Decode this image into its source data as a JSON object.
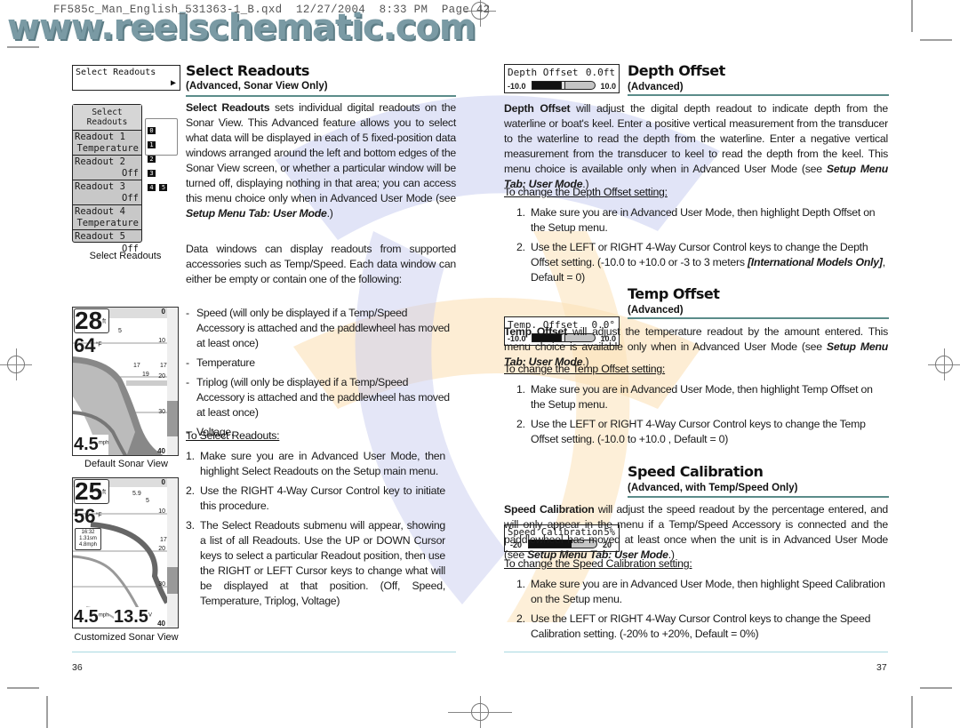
{
  "file_header": "FF585c_Man_English_531363-1_B.qxd  12/27/2004  8:33 PM  Page 42",
  "site_logo": "www.reelschematic.com",
  "left_page": {
    "select_menu_item": {
      "label": "Select Readouts",
      "arrow_icon": "right-triangle-icon"
    },
    "readouts_panel": {
      "title": "Select Readouts",
      "rows": [
        {
          "name": "Readout 1",
          "value": "Temperature"
        },
        {
          "name": "Readout 2",
          "value": "Off"
        },
        {
          "name": "Readout 3",
          "value": "Off"
        },
        {
          "name": "Readout 4",
          "value": "Temperature"
        },
        {
          "name": "Readout 5",
          "value": "Off"
        }
      ],
      "position_map": [
        "0",
        "1",
        "2",
        "3",
        "4",
        "5"
      ]
    },
    "readouts_caption": "Select Readouts",
    "default_sonar": {
      "depth": "28",
      "depth_unit": "ft",
      "temp": "64",
      "temp_unit": "°F",
      "speed": "4.5",
      "speed_unit": "mph",
      "scale": [
        "0",
        "10",
        "20",
        "30",
        "40"
      ],
      "fish_labels": [
        "5",
        "17",
        "19",
        "17"
      ],
      "caption": "Default Sonar View"
    },
    "custom_sonar": {
      "depth": "25",
      "depth_unit": "ft",
      "temp": "56",
      "temp_unit": "°F",
      "triplog": [
        "16:32",
        "1.31sm",
        "4.8mph"
      ],
      "speed": "4.5",
      "speed_unit": "mph",
      "voltage": "13.5",
      "voltage_unit": "V",
      "scale": [
        "0",
        "10",
        "20",
        "30",
        "40"
      ],
      "fish_labels": [
        "5.9",
        "5",
        "17"
      ],
      "caption": "Customized Sonar View"
    },
    "section": {
      "title": "Select Readouts",
      "subtitle": "(Advanced, Sonar View Only)",
      "intro_bold": "Select Readouts",
      "intro_rest": " sets individual digital readouts on the Sonar View. This Advanced feature allows you to select what data will be displayed in each of 5 fixed-position data windows arranged around the left and bottom edges of the Sonar View screen, or whether a particular window will be turned off, displaying nothing in that area; you can access this menu choice only when in Advanced User Mode (see ",
      "intro_ref": "Setup Menu Tab: User Mode",
      "intro_end": ".)",
      "para2": "Data windows can display readouts from supported accessories such as Temp/Speed. Each data window can either be empty or contain one of the following:",
      "options": [
        "Speed (will only be displayed if a Temp/Speed Accessory is attached and the paddlewheel has moved at least once)",
        "Temperature",
        "Triplog (will only be displayed if a Temp/Speed Accessory is attached and the paddlewheel has moved at least once)",
        "Voltage."
      ],
      "howto_title": "To Select Readouts:",
      "steps": [
        {
          "num": "1.",
          "text": "Make sure you are in Advanced User Mode, then highlight Select Readouts on the Setup main menu."
        },
        {
          "num": "2.",
          "text": "Use the RIGHT 4-Way Cursor Control key to initiate this procedure."
        },
        {
          "num": "3.",
          "text": "The Select Readouts submenu will appear, showing a list of all Readouts. Use the UP or DOWN Cursor keys to select a particular Readout position, then use the RIGHT or LEFT Cursor keys to change what will be displayed at that position. (Off, Speed, Temperature, Triplog, Voltage)"
        }
      ]
    },
    "page_number": "36"
  },
  "right_page": {
    "depth_offset": {
      "widget": {
        "label": "Depth Offset",
        "value": "0.0ft",
        "min": "-10.0",
        "max": "10.0",
        "position_fraction": 0.5
      },
      "title": "Depth Offset",
      "subtitle": "(Advanced)",
      "desc_bold": "Depth Offset",
      "desc_rest": " will adjust the digital depth readout to indicate depth from the waterline or boat's keel. Enter a positive vertical measurement from the transducer to the waterline to read the depth from the waterline. Enter a negative vertical measurement from the transducer to keel to read the depth from the keel. This menu choice is available only when in Advanced User Mode (see ",
      "desc_ref": "Setup Menu Tab: User Mode",
      "desc_end": ".)",
      "howto_title": "To change the Depth Offset setting:",
      "steps": [
        {
          "num": "1.",
          "text": "Make sure you are in Advanced User Mode, then highlight Depth Offset on the Setup menu."
        },
        {
          "num": "2.",
          "text_before": "Use the LEFT or RIGHT 4-Way Cursor Control keys to change the Depth Offset setting. (-10.0 to +10.0 or -3 to 3 meters ",
          "text_italic": "[International Models Only]",
          "text_after": ", Default = 0)"
        }
      ]
    },
    "temp_offset": {
      "widget": {
        "label": "Temp. Offset",
        "value": "0.0°",
        "min": "-10.0",
        "max": "10.0",
        "position_fraction": 0.5
      },
      "title": "Temp Offset",
      "subtitle": "(Advanced)",
      "desc_bold": "Temp Offset",
      "desc_rest": " will adjust the temperature readout by the amount entered. This menu choice is available only when in Advanced User Mode (see ",
      "desc_ref": "Setup Menu Tab: User Mode",
      "desc_end": ".)",
      "howto_title": "To change the Temp Offset setting:",
      "steps": [
        {
          "num": "1.",
          "text": "Make sure you are in Advanced User Mode, then highlight Temp Offset on the Setup menu."
        },
        {
          "num": "2.",
          "text": "Use the LEFT or RIGHT 4-Way Cursor Control keys to change the Temp Offset setting. (-10.0 to +10.0 , Default = 0)"
        }
      ]
    },
    "speed_calibration": {
      "widget": {
        "label": "Speed Calibration",
        "value": "5%",
        "min": "-20",
        "max": "20",
        "position_fraction": 0.625
      },
      "title": "Speed Calibration",
      "subtitle": "(Advanced, with Temp/Speed Only)",
      "desc_bold": "Speed Calibration",
      "desc_rest": " will adjust the speed readout by the percentage entered, and will only appear in the menu if a Temp/Speed Accessory is connected and the paddlewheel has moved at least once when the unit is in Advanced User Mode (see ",
      "desc_ref": "Setup Menu Tab: User Mode",
      "desc_end": ".)",
      "howto_title": "To change the Speed Calibration setting:",
      "steps": [
        {
          "num": "1.",
          "text": "Make sure you are in Advanced User Mode, then highlight Speed Calibration on the Setup menu."
        },
        {
          "num": "2.",
          "text": "Use the LEFT or RIGHT 4-Way Cursor Control keys to change the Speed Calibration setting. (-20% to +20%, Default = 0%)"
        }
      ]
    },
    "page_number": "37"
  },
  "colors": {
    "rule": "#5b8c8a",
    "rule_thin": "#a8d8e0",
    "watermark_blue": "#c9cdf0",
    "watermark_orange": "#fbe1b8"
  }
}
